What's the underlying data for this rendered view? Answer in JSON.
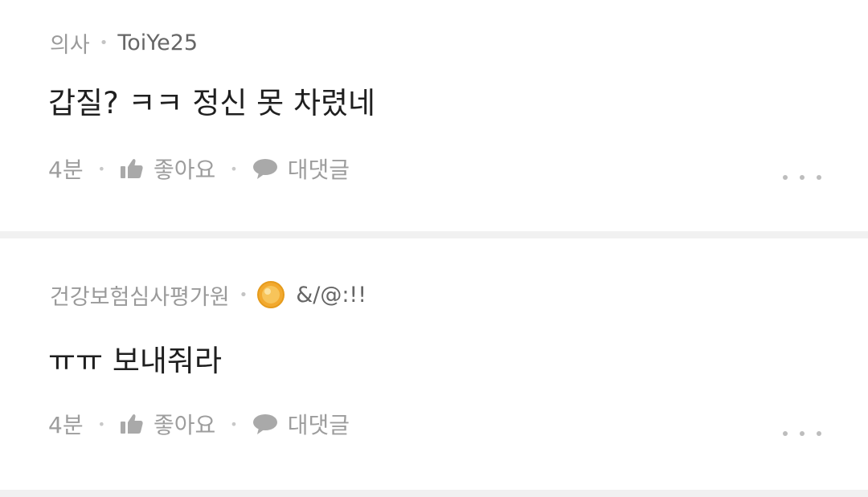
{
  "comments": [
    {
      "author_tag": "의사",
      "nickname": "ToiYe25",
      "text": "갑질? ㅋㅋ 정신 못 차렸네",
      "time": "4분",
      "like_label": "좋아요",
      "reply_label": "대댓글",
      "has_badge": false
    },
    {
      "author_tag": "건강보험심사평가원",
      "nickname": "&/@:!!",
      "text": "ㅠㅠ 보내줘라",
      "time": "4분",
      "like_label": "좋아요",
      "reply_label": "대댓글",
      "has_badge": true
    }
  ],
  "icons": {
    "like": "thumbs-up-icon",
    "reply": "speech-bubble-icon",
    "more": "more-dots-icon",
    "badge": "gold-coin-badge-icon"
  },
  "colors": {
    "background": "#f1f1f1",
    "card": "#ffffff",
    "meta_text": "#9a9a9a",
    "body_text": "#1f1f1f",
    "badge_gold": "#f2a92e"
  }
}
